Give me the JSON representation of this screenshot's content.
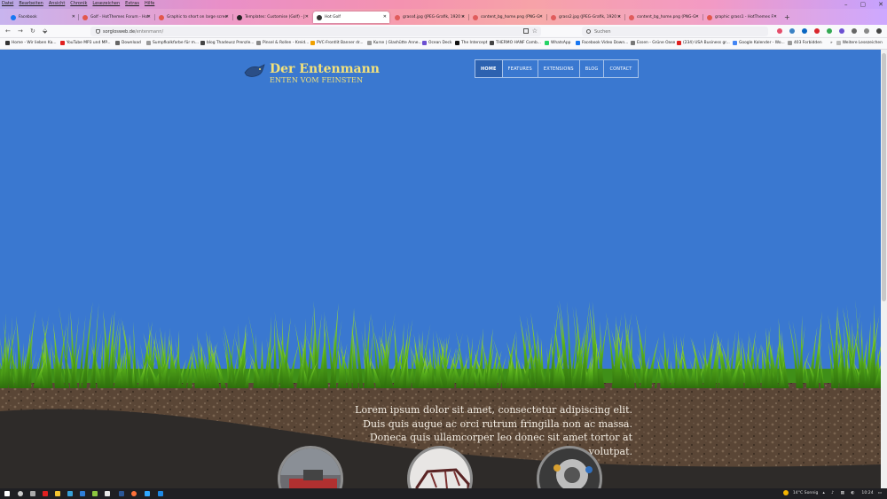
{
  "menubar": {
    "items": [
      "Datei",
      "Bearbeiten",
      "Ansicht",
      "Chronik",
      "Lesezeichen",
      "Extras",
      "Hilfe"
    ]
  },
  "tabs": [
    {
      "title": "Facebook",
      "color": "#1877f2"
    },
    {
      "title": "Golf - HotThemes Forum - Hot",
      "color": "#e2574c"
    },
    {
      "title": "Graphic to short on large scree",
      "color": "#e2574c"
    },
    {
      "title": "Templates: Customise (Golf) - J",
      "color": "#222222"
    },
    {
      "title": "Hot Golf",
      "color": "#333333"
    },
    {
      "title": "grass4.jpg (JPEG-Grafik, 1920 ×",
      "color": "#e05c5c"
    },
    {
      "title": "content_bg_home.png (PNG-G",
      "color": "#e05c5c"
    },
    {
      "title": "grass2.jpg (JPEG-Grafik, 1920 ×",
      "color": "#e05c5c"
    },
    {
      "title": "content_bg_home.png (PNG-G",
      "color": "#e05c5c"
    },
    {
      "title": "graphic grass1 - HotThemes F",
      "color": "#e2574c"
    }
  ],
  "active_tab_index": 4,
  "address_bar": {
    "host": "sorglosweb.de",
    "path": "/entenmann/"
  },
  "search_bar": {
    "placeholder": "Suchen"
  },
  "bookmarks": [
    "Home - Wir lieben Ka...",
    "YouTube MP3 und MP...",
    "Download",
    "Sumpfkalkfarbe für m...",
    "blog Thadeusz Prenzle...",
    "Pinsel & Rollen - Kreid...",
    "PVC-Frontlit Banner dr...",
    "Kurse | Glashütte Anne...",
    "Ocean Deck",
    "The Intercept",
    "THERMO HANF Comb...",
    "WhatsApp",
    "Facebook Video Down...",
    "Essen - Grüne Oase",
    "(234) USA Business gr...",
    "Google Kalender - Wo...",
    "403 Forbidden",
    "Weitere Lesezeichen"
  ],
  "site": {
    "title": "Der Entenmann",
    "tagline": "ENTEN VOM FEINSTEN",
    "nav": [
      "HOME",
      "FEATURES",
      "EXTENSIONS",
      "BLOG",
      "CONTACT"
    ],
    "active_nav_index": 0,
    "hero_text": "Lorem ipsum dolor sit amet, consectetur adipiscing elit. Duis quis augue ac orci rutrum fringilla non ac massa. Doneca quis ullamcorper leo donec sit amet tortor at volutpat.",
    "colors": {
      "sky": "#3a78d0",
      "title": "#f4e27a",
      "soil": "#5a4636",
      "dark_band": "#2e2b29"
    }
  },
  "taskbar": {
    "weather": "14°C  Sonnig",
    "time": "10:24"
  }
}
